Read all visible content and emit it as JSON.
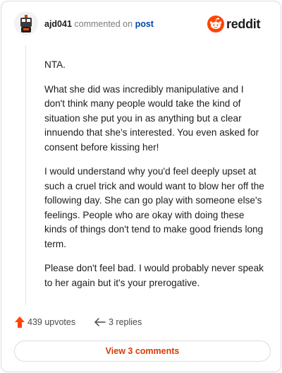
{
  "header": {
    "username": "ajd041",
    "action_text": "commented on",
    "post_link": "post",
    "brand_icon": "reddit-alien-icon",
    "brand_name": "reddit",
    "avatar_icon": "snoo-avatar",
    "colors": {
      "brand": "#ff4500",
      "link": "#0045ac",
      "accent": "#d93a00"
    }
  },
  "comment": {
    "paragraphs": [
      "NTA.",
      "What she did was incredibly manipulative and I don't think many people would take the kind of situation she put you in as anything but a clear innuendo that she's interested. You even asked for consent before kissing her!",
      "I would understand why you'd feel deeply upset at such a cruel trick and would want to blow her off the following day. She can go play with someone else's feelings. People who are okay with doing these kinds of things don't tend to make good friends long term.",
      "Please don't feel bad. I would probably never speak to her again but it's your prerogative."
    ]
  },
  "actions": {
    "upvote_icon": "upvote-arrow-icon",
    "upvotes": "439 upvotes",
    "reply_icon": "reply-arrow-icon",
    "replies": "3 replies"
  },
  "footer": {
    "view_comments": "View 3 comments"
  }
}
